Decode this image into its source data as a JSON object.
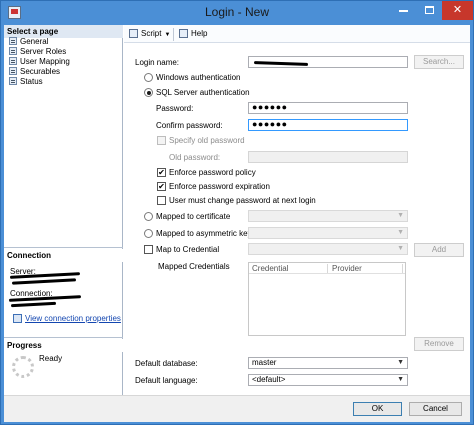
{
  "window": {
    "title": "Login - New"
  },
  "left": {
    "select_page_header": "Select a page",
    "pages": [
      "General",
      "Server Roles",
      "User Mapping",
      "Securables",
      "Status"
    ],
    "connection_header": "Connection",
    "server_label": "Server:",
    "connection_label": "Connection:",
    "view_connection_link": "View connection properties",
    "progress_header": "Progress",
    "progress_status": "Ready"
  },
  "toolbar": {
    "script_label": "Script",
    "help_label": "Help"
  },
  "form": {
    "login_name_label": "Login name:",
    "search_button": "Search...",
    "windows_auth_label": "Windows authentication",
    "sql_auth_label": "SQL Server authentication",
    "password_label": "Password:",
    "password_value": "●●●●●●",
    "confirm_password_label": "Confirm password:",
    "confirm_password_value": "●●●●●●",
    "specify_old_password_label": "Specify old password",
    "old_password_label": "Old password:",
    "enforce_policy_label": "Enforce password policy",
    "enforce_expiration_label": "Enforce password expiration",
    "must_change_label": "User must change password at next login",
    "mapped_cert_label": "Mapped to certificate",
    "mapped_asym_label": "Mapped to asymmetric key",
    "map_credential_label": "Map to Credential",
    "add_button": "Add",
    "mapped_credentials_label": "Mapped Credentials",
    "grid_col_credential": "Credential",
    "grid_col_provider": "Provider",
    "remove_button": "Remove",
    "default_database_label": "Default database:",
    "default_database_value": "master",
    "default_language_label": "Default language:",
    "default_language_value": "<default>"
  },
  "footer": {
    "ok_button": "OK",
    "cancel_button": "Cancel"
  }
}
